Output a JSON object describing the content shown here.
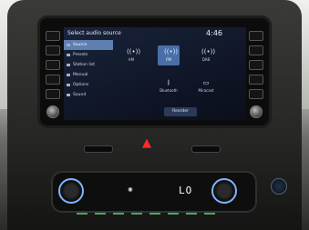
{
  "screen": {
    "title": "Select audio source",
    "clock": "4:46",
    "menu": [
      {
        "label": "Source",
        "selected": true
      },
      {
        "label": "Presets",
        "selected": false
      },
      {
        "label": "Station list",
        "selected": false
      },
      {
        "label": "Manual",
        "selected": false
      },
      {
        "label": "Options",
        "selected": false
      },
      {
        "label": "Sound",
        "selected": false
      }
    ],
    "sources": [
      {
        "label": "AM",
        "icon": "radio-waves-icon",
        "selected": false
      },
      {
        "label": "FM",
        "icon": "radio-waves-icon",
        "selected": true
      },
      {
        "label": "DAB",
        "icon": "radio-waves-icon",
        "selected": false
      },
      {
        "label": "Bluetooth",
        "icon": "bluetooth-icon",
        "selected": false
      },
      {
        "label": "Miracast",
        "icon": "screen-cast-icon",
        "selected": false
      }
    ],
    "reorder_label": "Reorder"
  },
  "climate": {
    "temperature_display": "LO"
  },
  "colors": {
    "selected_tile": "#4a6fa8",
    "hazard": "#ff2a2a",
    "dial_ring": "#7db4ff"
  }
}
